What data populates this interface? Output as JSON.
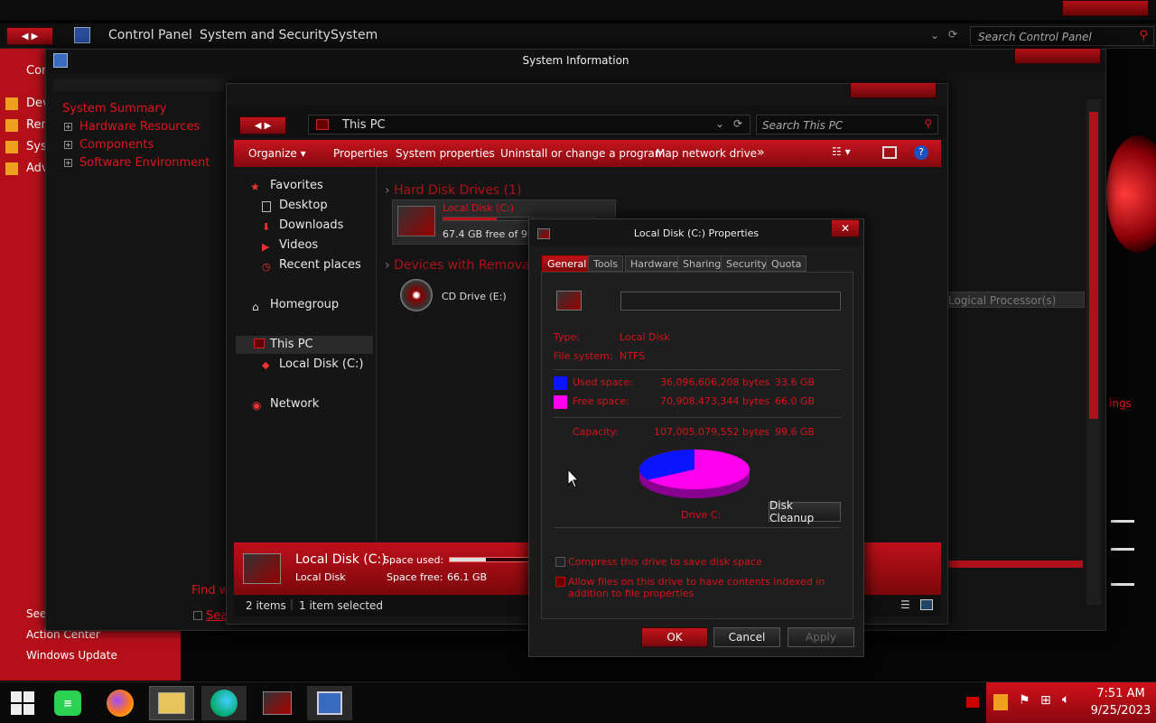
{
  "control_panel": {
    "breadcrumb": [
      "Control Panel",
      "System and Security",
      "System"
    ],
    "search_placeholder": "Search Control Panel",
    "left_partial": [
      "Con",
      "Dev",
      "Rem",
      "Syst",
      "Adv"
    ],
    "see_also": "See",
    "action_center": "Action Center",
    "windows_update": "Windows Update"
  },
  "sysinfo": {
    "title": "System Information",
    "summary": "System Summary",
    "tree": [
      "Hardware Resources",
      "Components",
      "Software Environment"
    ],
    "find_partial": "Find w",
    "search_partial": "Sea",
    "column_header": "Logical Processor(s)",
    "right_partial": "ings"
  },
  "this_pc": {
    "address": "This PC",
    "search_placeholder": "Search This PC",
    "toolbar": [
      "Organize",
      "Properties",
      "System properties",
      "Uninstall or change a program",
      "Map network drive"
    ],
    "more": "»",
    "nav": {
      "favorites": "Favorites",
      "fav_items": [
        "Desktop",
        "Downloads",
        "Videos",
        "Recent places"
      ],
      "homegroup": "Homegroup",
      "this_pc": "This PC",
      "local_disk": "Local Disk (C:)",
      "network": "Network"
    },
    "group_hdd": "Hard Disk Drives (1)",
    "drive_c_name": "Local Disk (C:)",
    "drive_c_free": "67.4 GB free of 99.6",
    "group_removable": "Devices with Removabl",
    "cd_drive": "CD Drive (E:)",
    "details": {
      "name": "Local Disk (C:)",
      "type": "Local Disk",
      "space_used_label": "Space used:",
      "space_free_label": "Space free:",
      "space_free": "66.1 GB",
      "used_fraction": 0.34
    },
    "status_items": "2 items",
    "status_selected": "1 item selected"
  },
  "dialog": {
    "title": "Local Disk (C:) Properties",
    "tabs": [
      "General",
      "Tools",
      "Hardware",
      "Sharing",
      "Security",
      "Quota"
    ],
    "label_value": "",
    "type_label": "Type:",
    "type_value": "Local Disk",
    "fs_label": "File system:",
    "fs_value": "NTFS",
    "used_label": "Used space:",
    "used_bytes": "36,096,606,208 bytes",
    "used_gb": "33.6 GB",
    "free_label": "Free space:",
    "free_bytes": "70,908,473,344 bytes",
    "free_gb": "66.0 GB",
    "capacity_label": "Capacity:",
    "capacity_bytes": "107,005,079,552 bytes",
    "capacity_gb": "99.6 GB",
    "drive_label": "Drive C:",
    "disk_cleanup": "Disk Cleanup",
    "compress": "Compress this drive to save disk space",
    "index": "Allow files on this drive to have contents indexed in addition to file properties",
    "ok": "OK",
    "cancel": "Cancel",
    "apply": "Apply",
    "colors": {
      "used": "#0a14ff",
      "free": "#ff00ee"
    }
  },
  "taskbar": {
    "time": "7:51 AM",
    "date": "9/25/2023"
  }
}
